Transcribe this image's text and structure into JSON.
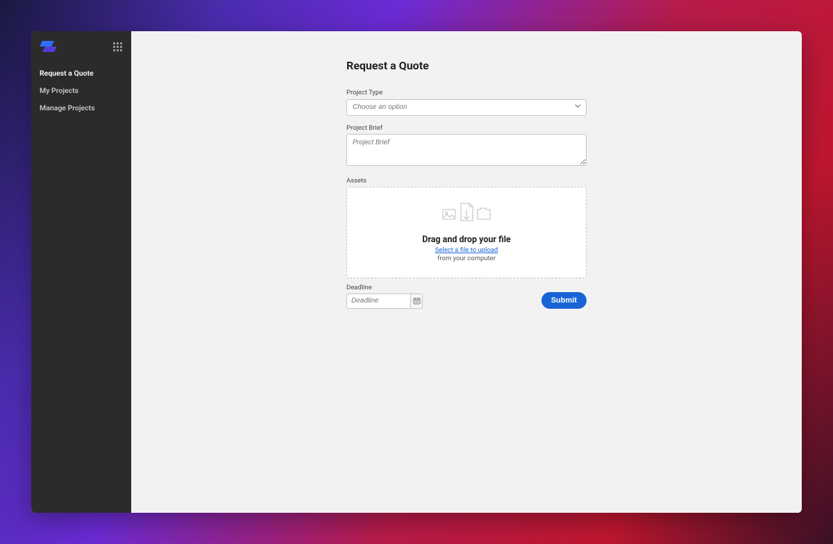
{
  "sidebar": {
    "nav_items": [
      {
        "label": "Request a Quote",
        "active": true
      },
      {
        "label": "My Projects",
        "active": false
      },
      {
        "label": "Manage Projects",
        "active": false
      }
    ]
  },
  "page": {
    "title": "Request a Quote"
  },
  "form": {
    "project_type": {
      "label": "Project Type",
      "placeholder": "Choose an option",
      "value": ""
    },
    "project_brief": {
      "label": "Project Brief",
      "placeholder": "Project Brief",
      "value": ""
    },
    "assets": {
      "label": "Assets",
      "dropzone_title": "Drag and drop your file",
      "dropzone_link": "Select a file to upload",
      "dropzone_subtext": "from your computer"
    },
    "deadline": {
      "label": "Deadline",
      "placeholder": "Deadline",
      "value": ""
    },
    "submit_label": "Submit"
  },
  "colors": {
    "accent": "#1864d6",
    "sidebar_bg": "#2b2b2b"
  }
}
